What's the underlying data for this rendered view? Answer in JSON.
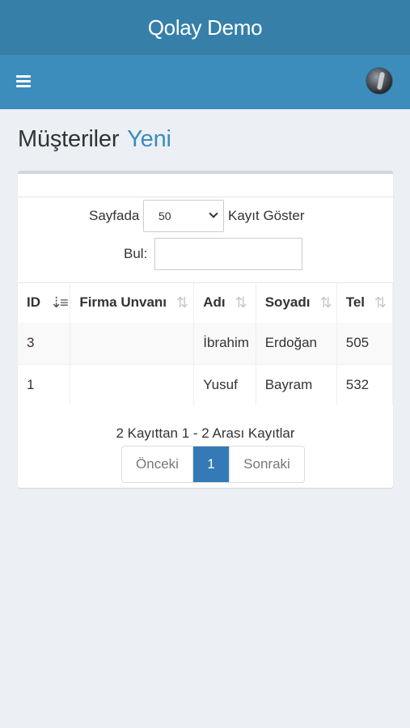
{
  "app": {
    "title": "Qolay Demo"
  },
  "header": {
    "title": "Müşteriler",
    "subtitle": "Yeni"
  },
  "table_controls": {
    "length_prefix": "Sayfada",
    "length_value": "50",
    "length_suffix": "Kayıt Göster",
    "search_label": "Bul:",
    "search_value": ""
  },
  "table": {
    "columns": [
      "ID",
      "Firma Unvanı",
      "Adı",
      "Soyadı",
      "Tel"
    ],
    "rows": [
      [
        "3",
        "",
        "İbrahim",
        "Erdoğan",
        "505"
      ],
      [
        "1",
        "",
        "Yusuf",
        "Bayram",
        "532"
      ]
    ]
  },
  "footer": {
    "info": "2 Kayıttan 1 - 2 Arası Kayıtlar",
    "prev": "Önceki",
    "current_page": "1",
    "next": "Sonraki"
  },
  "icons": {
    "menu": "hamburger-menu-icon",
    "avatar": "user-avatar",
    "sort_active": "sort-desc-icon",
    "sort": "sort-both-icon",
    "select": "chevron-down-icon"
  },
  "colors": {
    "titlebar": "#367fa9",
    "navbar": "#3c8dbc",
    "accent": "#3c8dbc",
    "pagination_active": "#337ab7",
    "background": "#ecf0f5"
  }
}
